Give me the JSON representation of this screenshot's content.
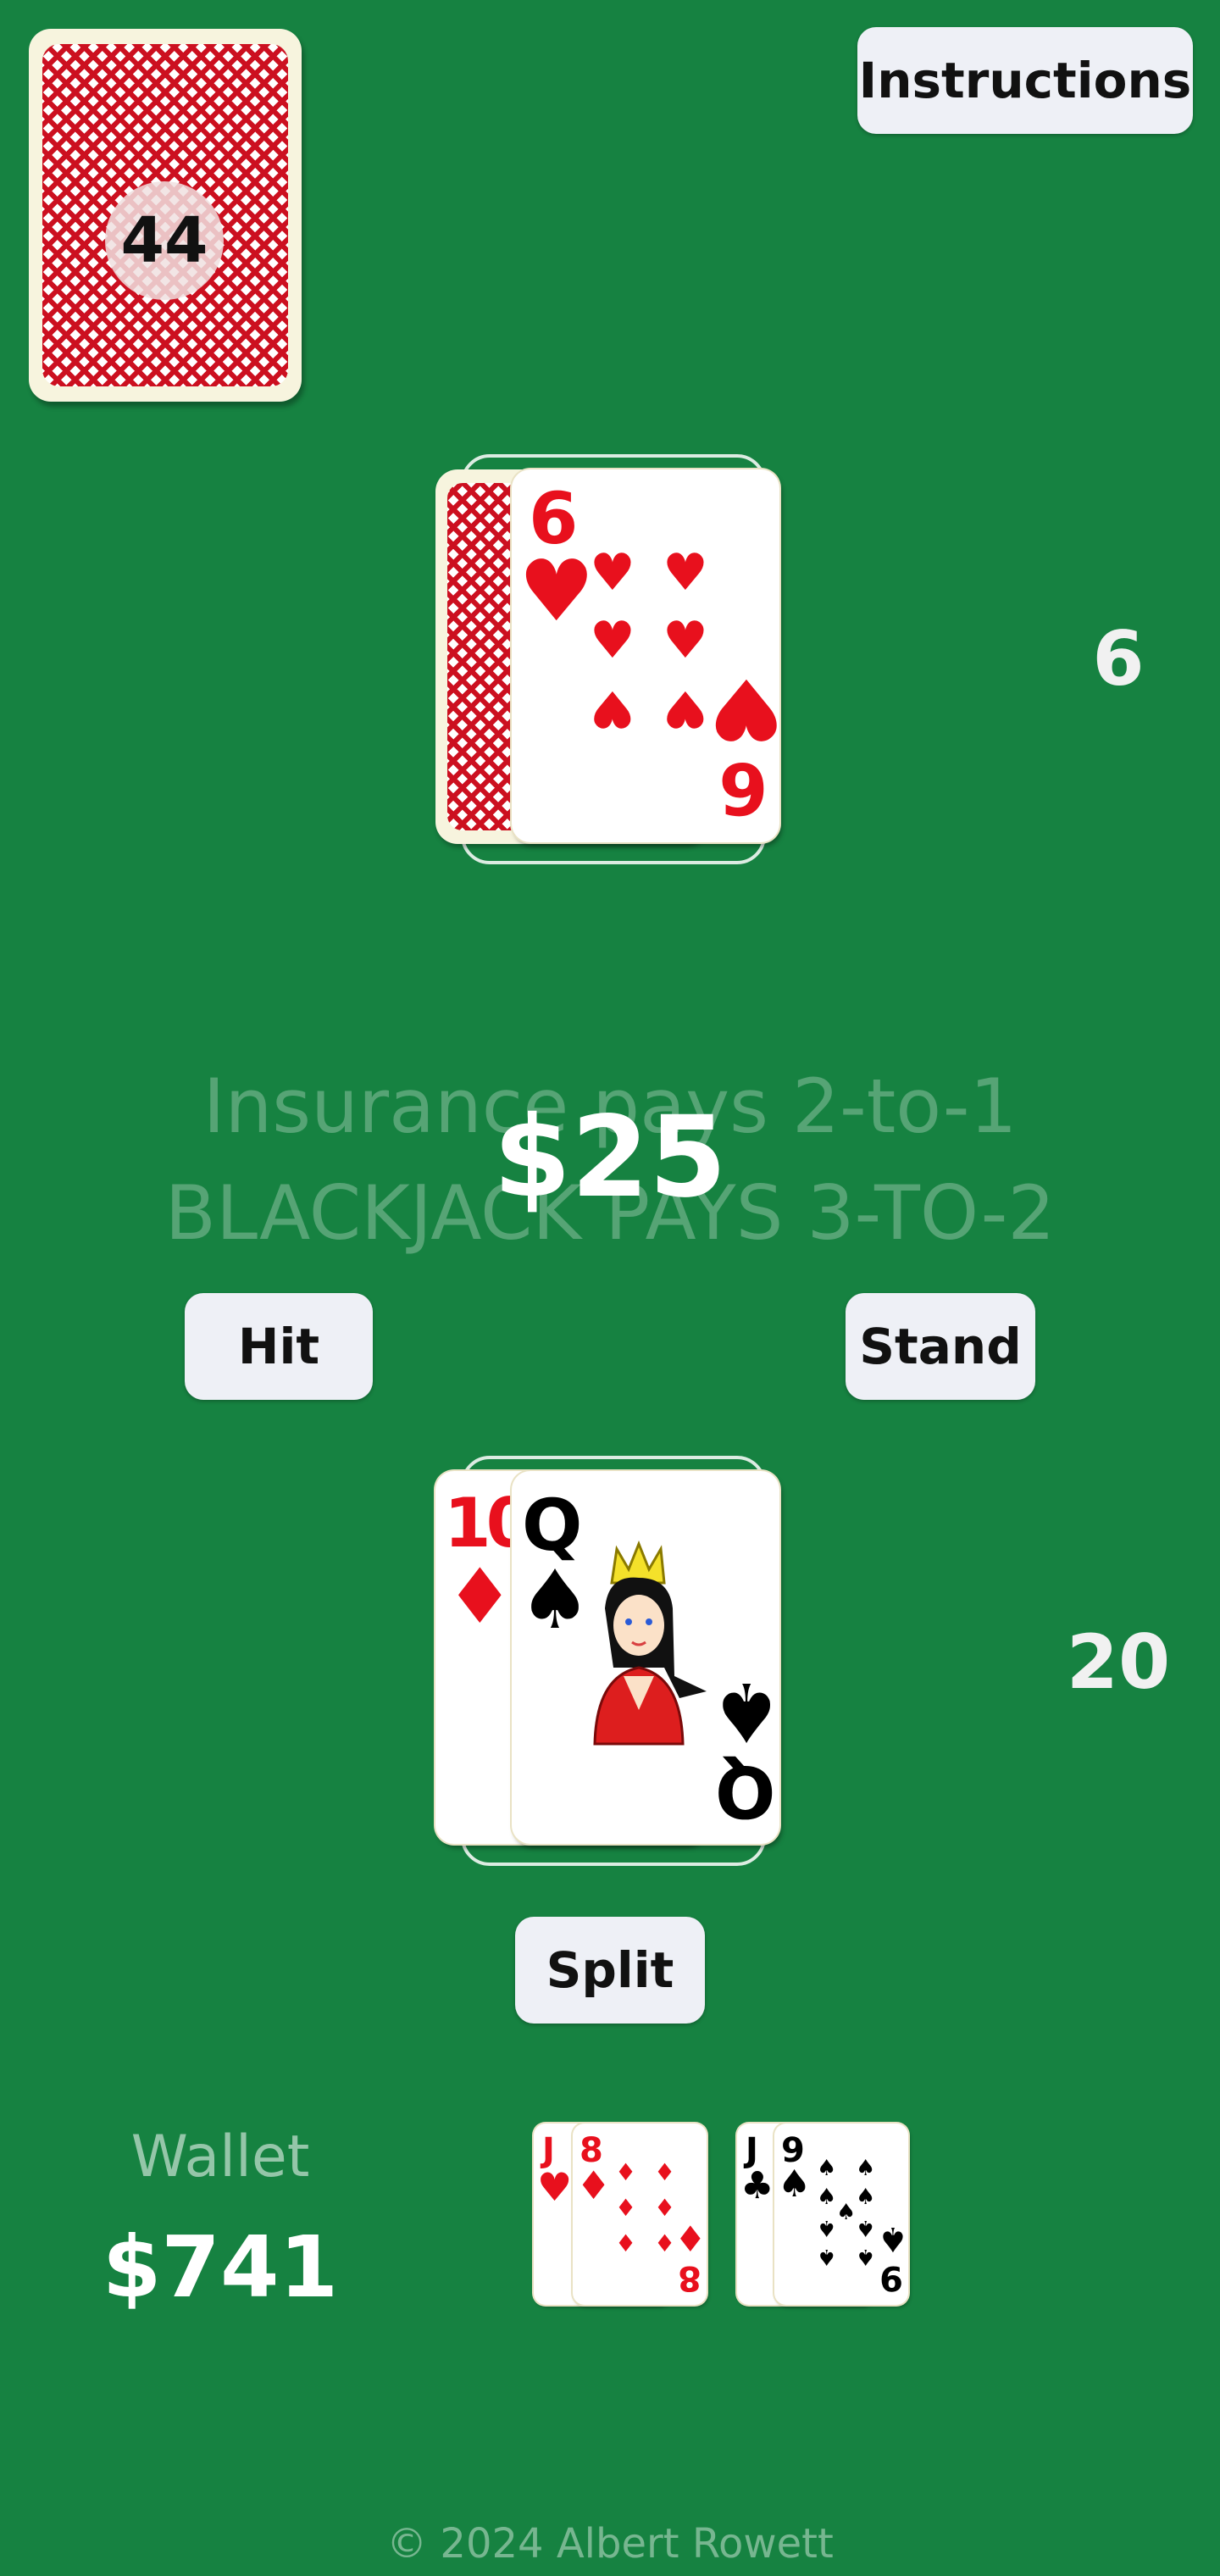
{
  "shoe": {
    "remaining": "44"
  },
  "buttons": {
    "instructions": "Instructions",
    "hit": "Hit",
    "stand": "Stand",
    "split": "Split"
  },
  "dealer": {
    "score": "6",
    "up_card": {
      "rank": "6",
      "suit": "hearts",
      "suit_glyph": "♥"
    },
    "hole_card": "face-down"
  },
  "table_rules": {
    "insurance": "Insurance pays 2-to-1",
    "blackjack": "BLACKJACK PAYS 3-TO-2"
  },
  "bet": {
    "amount": "$25"
  },
  "player": {
    "score": "20",
    "cards": [
      {
        "rank": "10",
        "suit": "diamonds",
        "suit_glyph": "♦"
      },
      {
        "rank": "Q",
        "suit": "spades",
        "suit_glyph": "♠"
      }
    ]
  },
  "wallet": {
    "label": "Wallet",
    "amount": "$741"
  },
  "discards": [
    {
      "cards": [
        {
          "rank": "J",
          "suit_glyph": "♥"
        },
        {
          "rank": "8",
          "suit_glyph": "♦"
        }
      ]
    },
    {
      "cards": [
        {
          "rank": "J",
          "suit_glyph": "♣"
        },
        {
          "rank": "9",
          "suit_glyph": "♠"
        }
      ]
    }
  ],
  "footer": {
    "copyright": "© 2024 Albert Rowett"
  },
  "colors": {
    "felt": "#168241",
    "card_red": "#e8101d",
    "button_bg": "#eef0f6"
  }
}
